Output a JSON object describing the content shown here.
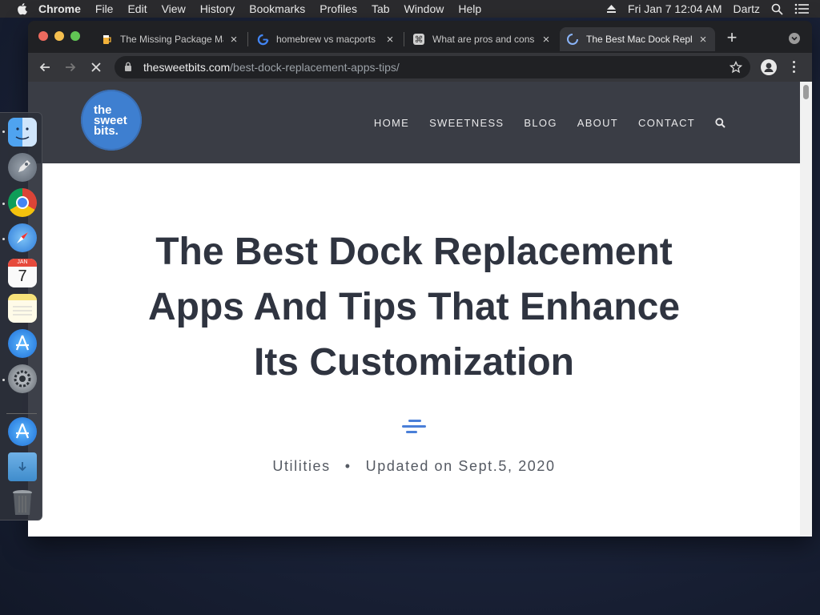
{
  "menubar": {
    "app": "Chrome",
    "items": [
      "File",
      "Edit",
      "View",
      "History",
      "Bookmarks",
      "Profiles",
      "Tab",
      "Window",
      "Help"
    ],
    "datetime": "Fri Jan 7  12:04 AM",
    "user": "Dartz"
  },
  "browser": {
    "tabs": [
      {
        "title": "The Missing Package Manager for macOS",
        "icon": "homebrew-beer-icon"
      },
      {
        "title": "homebrew vs macports",
        "icon": "google-icon"
      },
      {
        "title": "What are pros and cons",
        "icon": "command-key-icon"
      },
      {
        "title": "The Best Mac Dock Replacement",
        "icon": "loading-spinner-icon",
        "active": true
      }
    ],
    "url_host": "thesweetbits.com",
    "url_path": "/best-dock-replacement-apps-tips/"
  },
  "site": {
    "logo": [
      "the",
      "sweet",
      "bits."
    ],
    "nav": [
      "HOME",
      "SWEETNESS",
      "BLOG",
      "ABOUT",
      "CONTACT"
    ]
  },
  "article": {
    "title": "The Best Dock Replacement Apps And Tips That Enhance Its Customization",
    "category": "Utilities",
    "updated": "Updated on Sept.5, 2020"
  },
  "dock": {
    "apps": [
      "finder-icon",
      "launchpad-icon",
      "chrome-icon",
      "safari-icon",
      "calendar-icon",
      "notes-icon",
      "app-store-icon",
      "system-preferences-icon",
      "app-store-icon",
      "downloads-folder-icon",
      "trash-icon"
    ],
    "calendar_month": "JAN",
    "calendar_day": "7"
  },
  "colors": {
    "accent_blue": "#3e7fd0",
    "header_bg": "#3a3d45",
    "title_text": "#2f3440"
  }
}
